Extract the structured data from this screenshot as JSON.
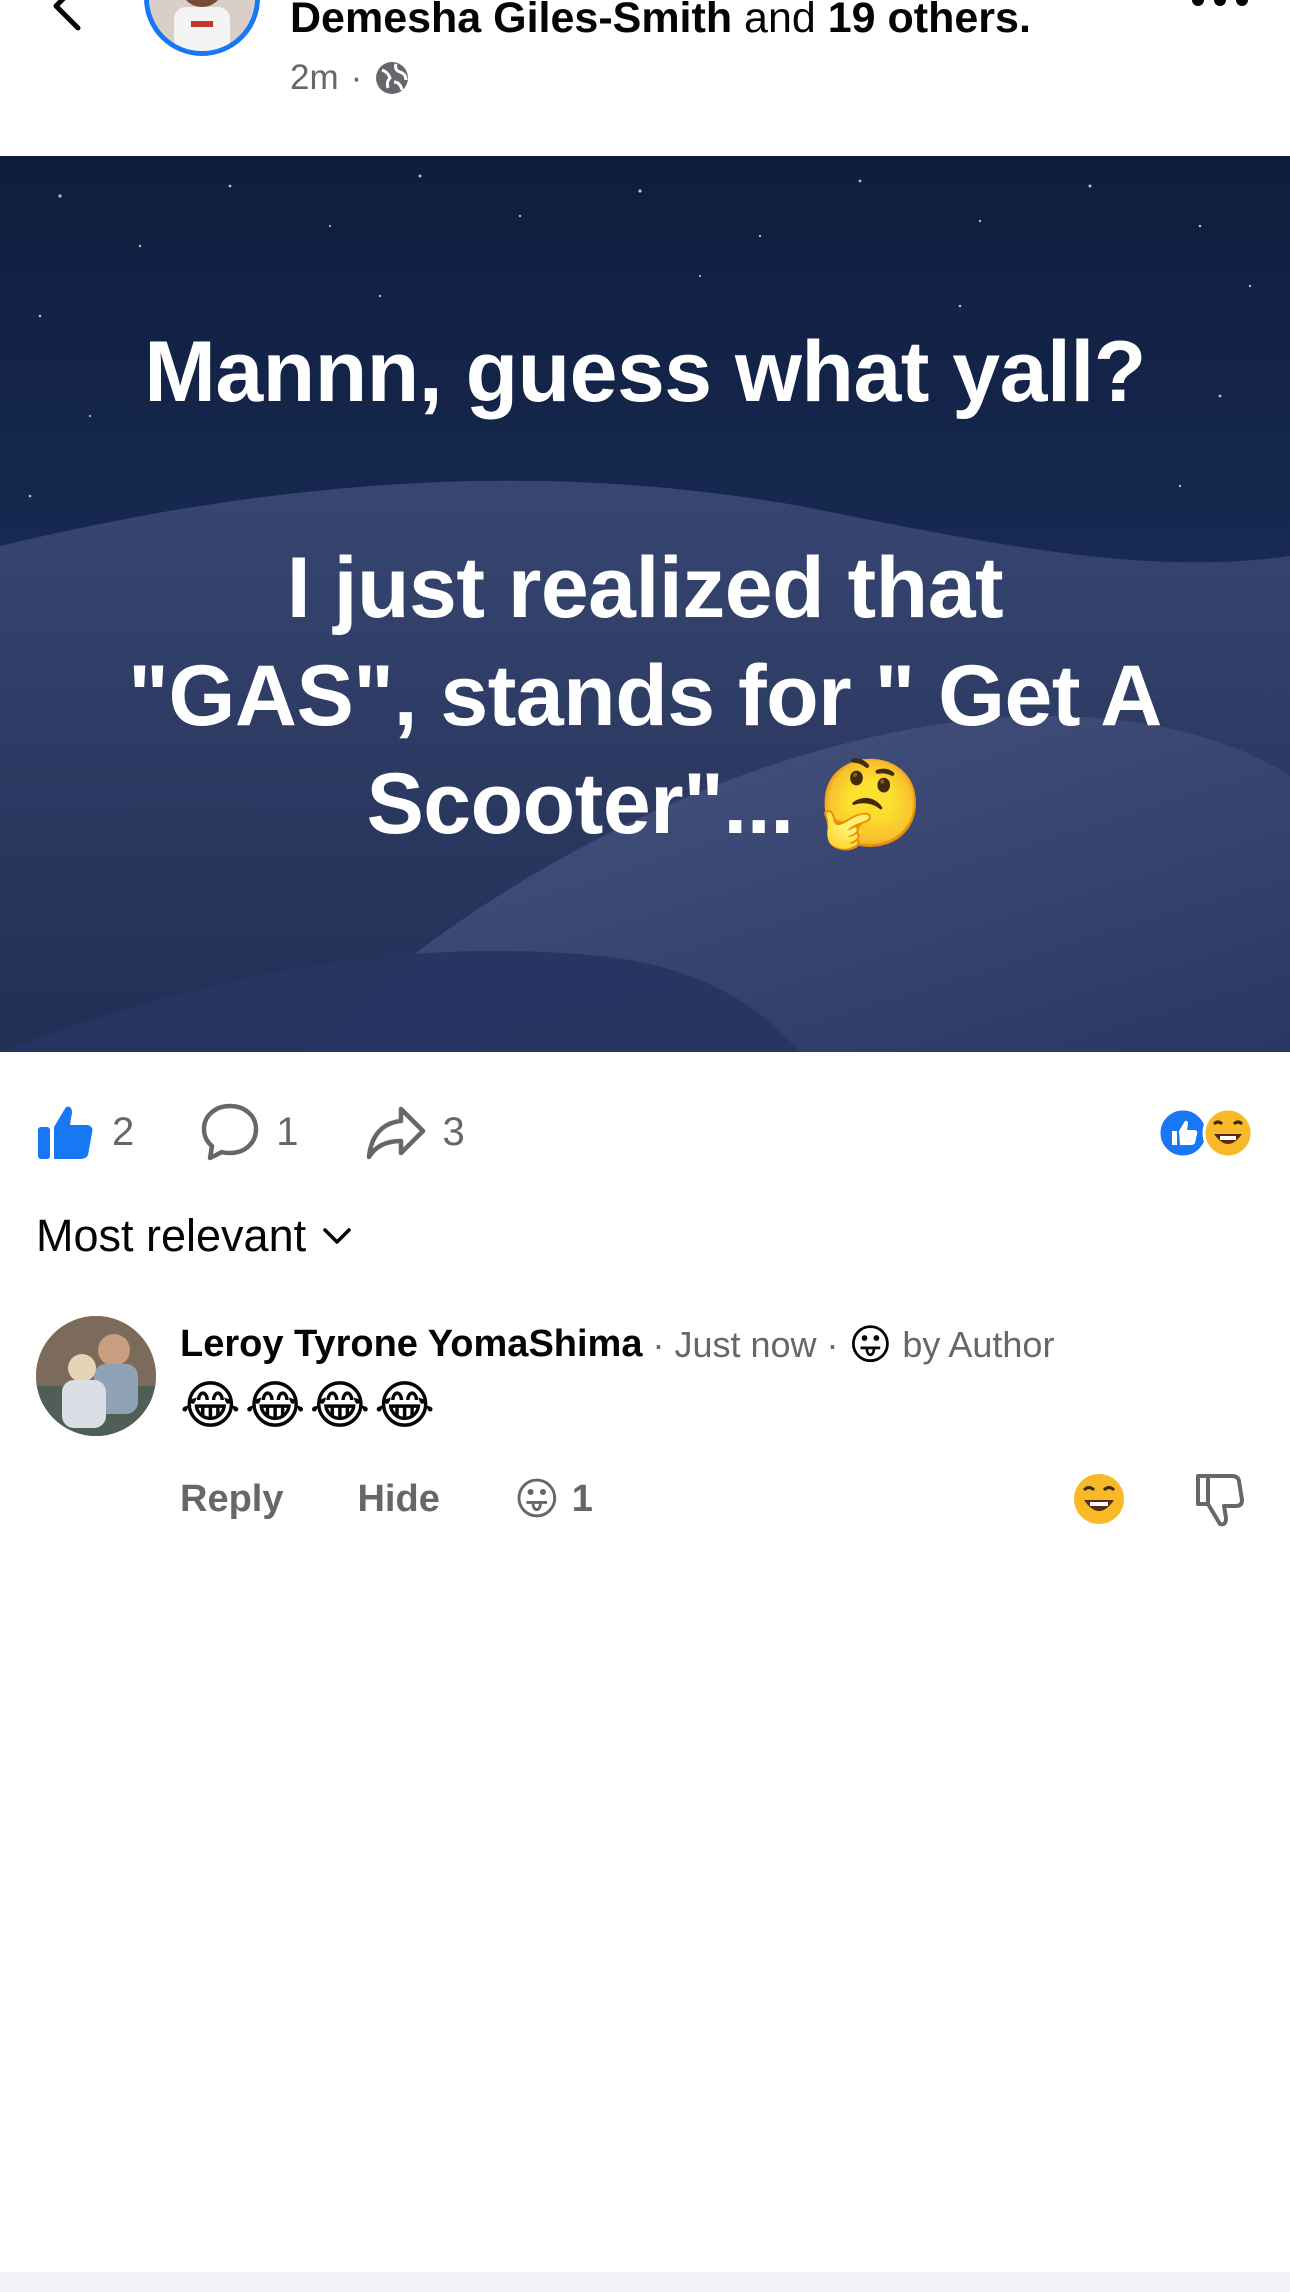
{
  "header": {
    "name": "Demesha Giles-Smith",
    "and_text": "and",
    "others": "19 others.",
    "time": "2m",
    "separator": "·"
  },
  "post": {
    "line1": "Mannn, guess what yall?",
    "line2": "I just realized that",
    "line3": "\"GAS\", stands for \" Get A",
    "line4": "Scooter\"... 🤔"
  },
  "actions": {
    "likes": "2",
    "comments": "1",
    "shares": "3"
  },
  "sort": {
    "label": "Most relevant"
  },
  "comment": {
    "author": "Leroy Tyrone YomaShima",
    "time": "· Just now ·",
    "author_reaction": "😛",
    "author_reaction_label": "by Author",
    "body": "😂😂😂😂",
    "reply_label": "Reply",
    "hide_label": "Hide",
    "reaction_emoji": "😛",
    "reaction_count": "1"
  },
  "colors": {
    "brand": "#1877f2",
    "secondary_text": "#65676b",
    "post_bg": "#16284f"
  }
}
